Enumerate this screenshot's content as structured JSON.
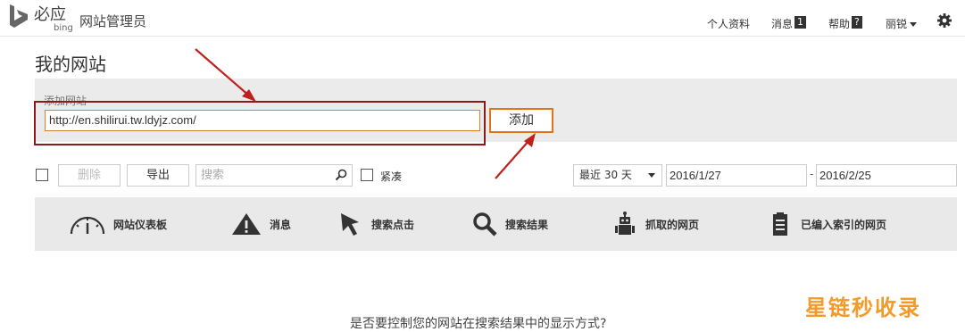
{
  "header": {
    "brand_cn": "必应",
    "brand_en": "bing",
    "app_title": "网站管理员",
    "nav": {
      "profile": "个人资料",
      "messages": "消息",
      "messages_count": "1",
      "help": "帮助",
      "help_badge": "?",
      "user": "丽锐"
    }
  },
  "page_title": "我的网站",
  "add_site": {
    "label": "添加网站",
    "url_value": "http://en.shilirui.tw.ldyjz.com/",
    "button": "添加"
  },
  "toolbar": {
    "delete": "删除",
    "export": "导出",
    "search_placeholder": "搜索",
    "compact": "紧凑",
    "range": "最近 30 天",
    "date_from": "2016/1/27",
    "date_sep": "-",
    "date_to": "2016/2/25"
  },
  "tiles": [
    {
      "label": "网站仪表板",
      "icon": "gauge-icon"
    },
    {
      "label": "消息",
      "icon": "warning-icon"
    },
    {
      "label": "搜索点击",
      "icon": "cursor-icon"
    },
    {
      "label": "搜索结果",
      "icon": "magnifier-icon"
    },
    {
      "label": "抓取的网页",
      "icon": "robot-icon"
    },
    {
      "label": "已编入索引的网页",
      "icon": "document-icon"
    }
  ],
  "bottom_text": "是否要控制您的网站在搜索结果中的显示方式?",
  "watermark": "星链秒收录",
  "colors": {
    "highlight_box": "#8b1a1a",
    "accent_orange": "#e27418",
    "annotation_arrow": "#c0201c",
    "watermark": "#f39a2a"
  }
}
